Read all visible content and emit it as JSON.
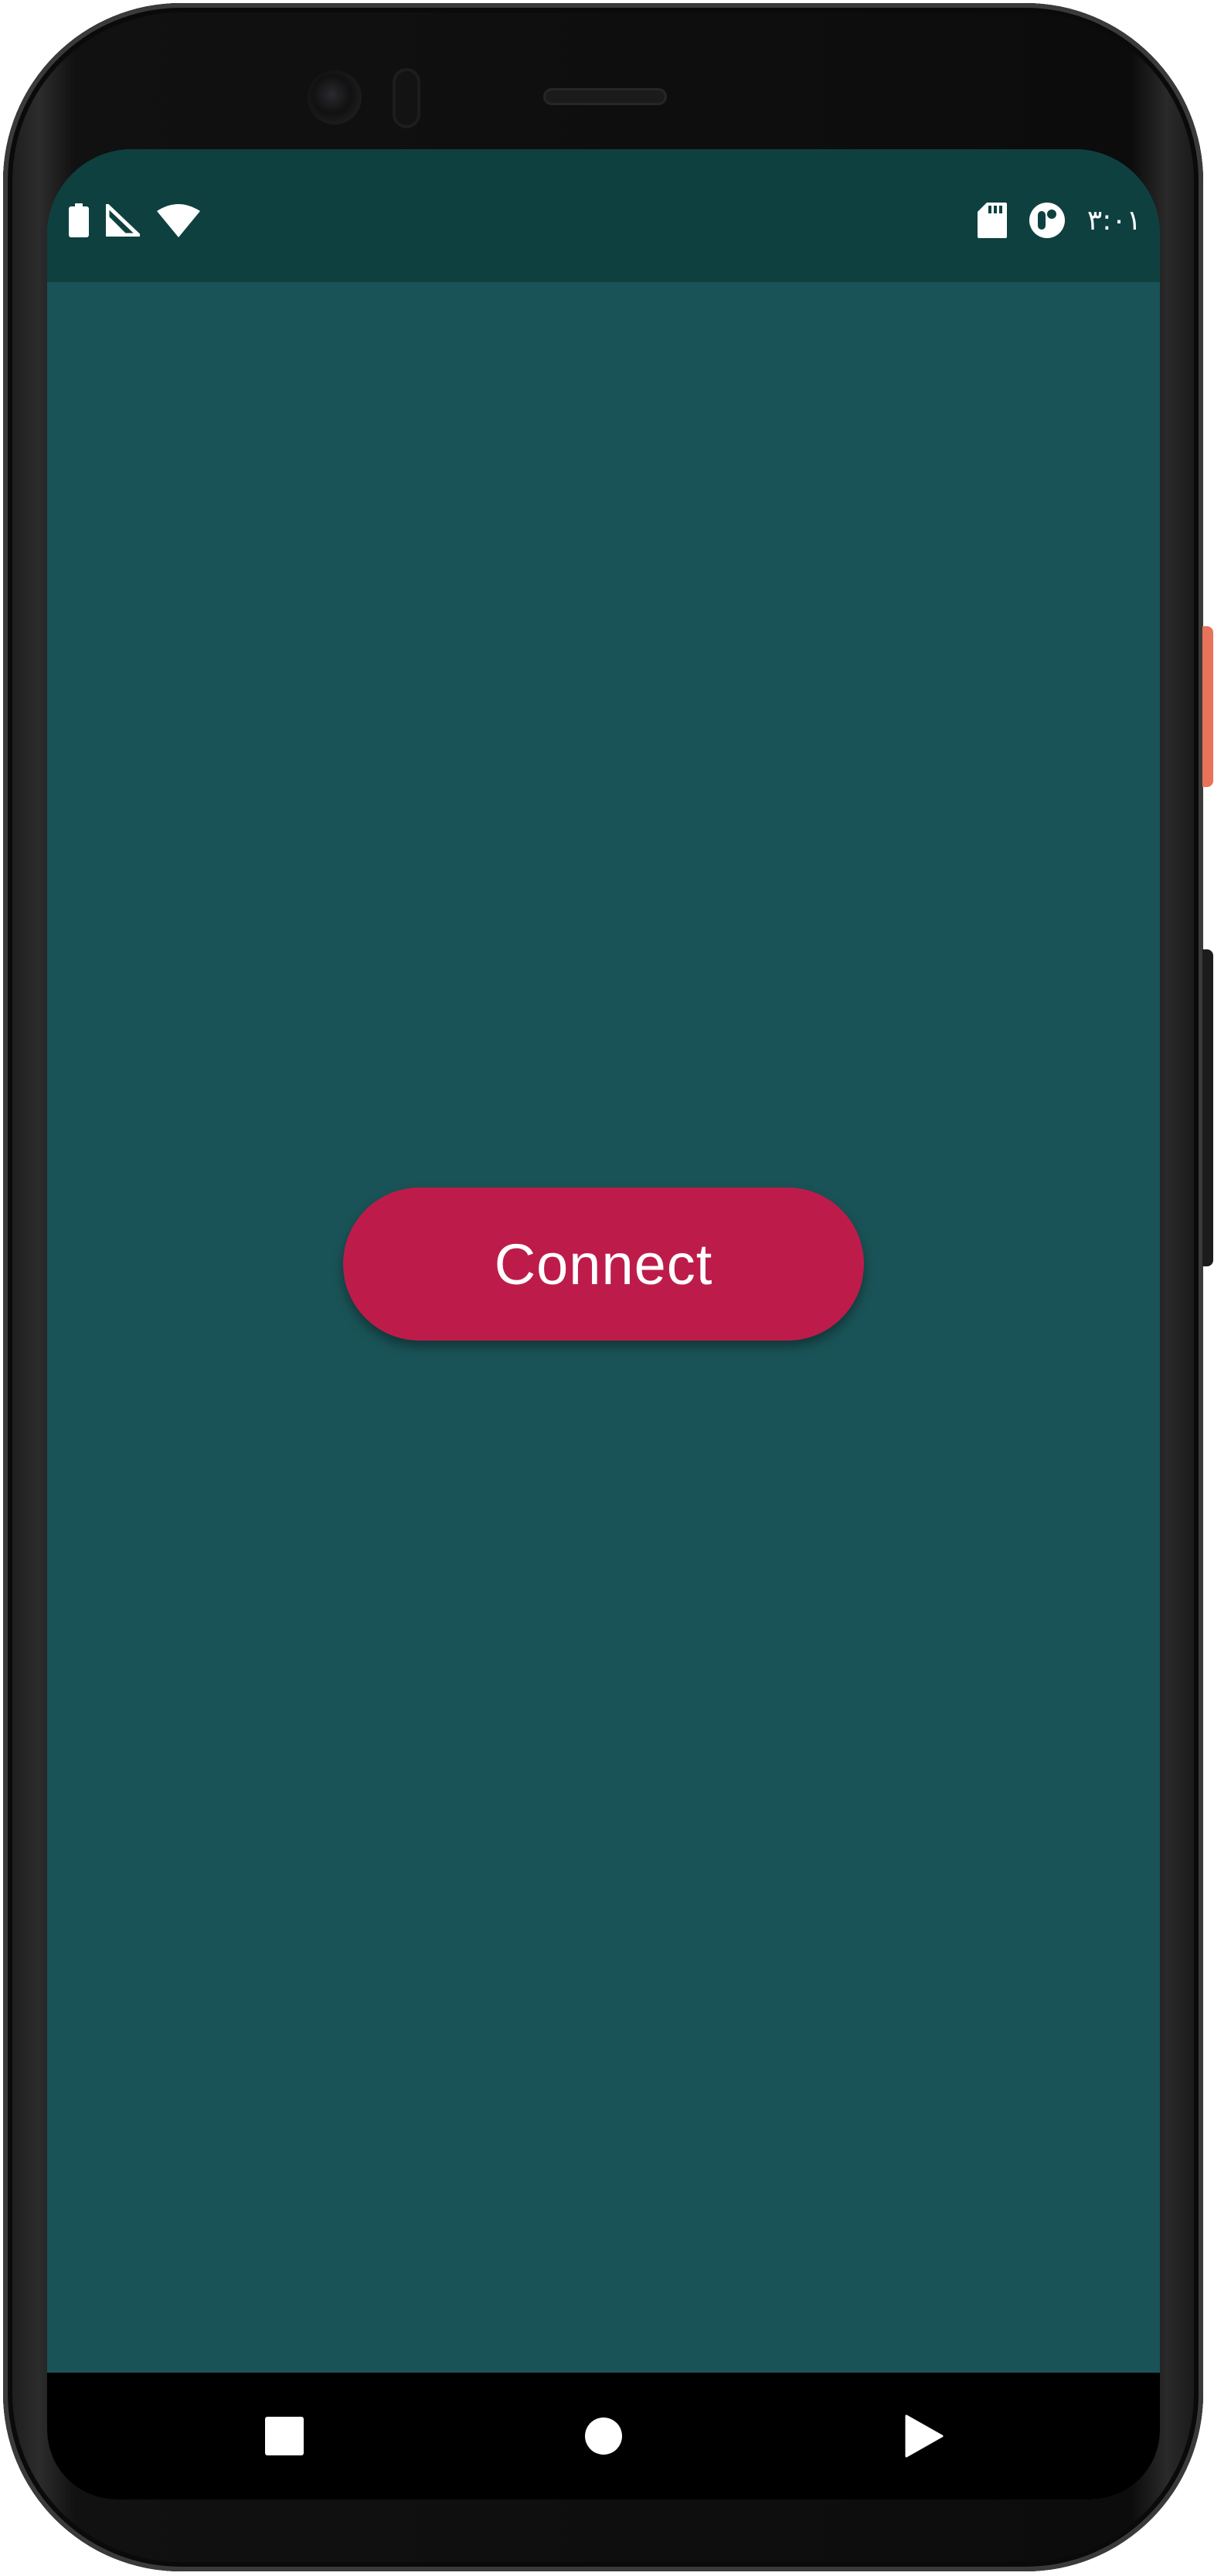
{
  "status_bar": {
    "time": "٣:٠١",
    "left_icons": [
      "battery-icon",
      "signal-icon",
      "wifi-icon"
    ],
    "right_icons": [
      "sd-card-icon",
      "sync-icon"
    ]
  },
  "main": {
    "connect_label": "Connect"
  },
  "nav_bar": {
    "buttons": [
      "recents-button",
      "home-button",
      "back-button"
    ]
  },
  "colors": {
    "status_bar": "#0f4040",
    "background": "#1a5357",
    "button": "#bd1c4b",
    "button_text": "#ffffff",
    "nav_bar": "#000000"
  }
}
